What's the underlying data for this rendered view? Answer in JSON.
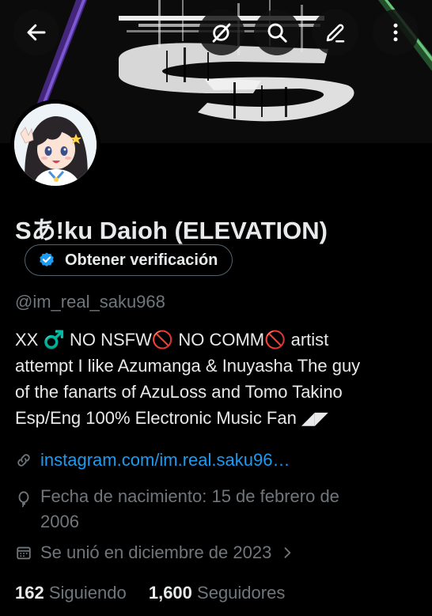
{
  "profile": {
    "name": "Sあ!ku Daioh (ELEVATION)",
    "verification_button": "Obtener verificación",
    "handle": "@im_real_saku968",
    "bio_lines": [
      "XX ♂️ NO NSFW🚫 NO COMM🚫 artist",
      "attempt I like Azumanga & Inuyasha The guy",
      "of the fanarts of AzuLoss and Tomo Takino",
      "Esp/Eng 100% Electronic Music Fan ◢◤"
    ],
    "link": "instagram.com/im.real.saku96…",
    "birthday_line1": "Fecha de nacimiento: 15 de febrero de",
    "birthday_line2": "2006",
    "joined": "Se unió en diciembre de 2023",
    "following_count": "162",
    "following_label": "Siguiendo",
    "followers_count": "1,600",
    "followers_label": "Seguidores"
  },
  "icons": {
    "back": "arrow-left-icon",
    "grok": "grok-icon",
    "search": "search-icon",
    "edit": "edit-icon",
    "more": "more-vertical-icon",
    "verified": "verified-badge-icon",
    "link": "link-icon",
    "birthday": "balloon-icon",
    "calendar": "calendar-icon",
    "chevron": "chevron-right-icon"
  },
  "colors": {
    "accent": "#1d9bf0",
    "background": "#000000",
    "text": "#e7e9ea",
    "muted": "#71767b"
  }
}
